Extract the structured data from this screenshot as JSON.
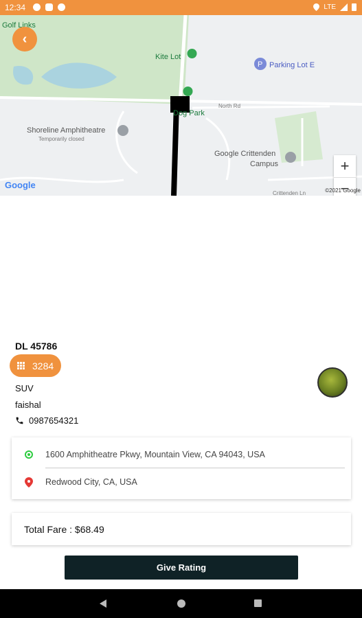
{
  "status_bar": {
    "time": "12:34",
    "network": "LTE"
  },
  "map": {
    "labels": {
      "golf_links": "Golf Links",
      "kite_lot": "Kite Lot",
      "parking_lot_e": "Parking Lot E",
      "dog_park": "Dog Park",
      "north_rd": "North Rd",
      "shoreline_amphitheatre": "Shoreline Amphitheatre",
      "temporarily_closed": "Temporarily closed",
      "google_crittenden_campus_1": "Google Crittenden",
      "google_crittenden_campus_2": "Campus",
      "crittenden_ln": "Crittenden Ln"
    },
    "google_logo": "Google",
    "copyright": "©2021 Google",
    "zoom_in": "+",
    "zoom_out": "−"
  },
  "trip": {
    "vehicle_plate": "DL 45786",
    "otp_code": "3284",
    "vehicle_type": "SUV",
    "driver_name": "faishal",
    "driver_phone": "0987654321",
    "pickup": "1600 Amphitheatre Pkwy, Mountain View, CA 94043, USA",
    "dropoff": "Redwood City, CA, USA",
    "total_fare": "Total Fare : $68.49"
  },
  "actions": {
    "give_rating": "Give Rating"
  },
  "colors": {
    "accent": "#f0923e",
    "button": "#0f2226",
    "pickup_icon": "#2ecc40",
    "dropoff_icon": "#e53935"
  }
}
